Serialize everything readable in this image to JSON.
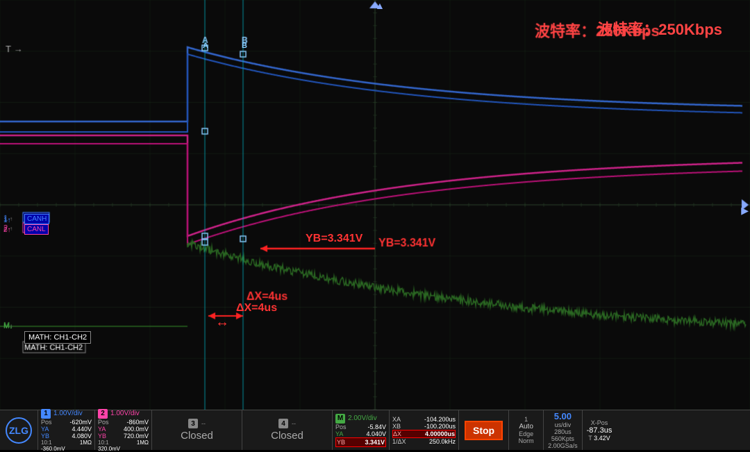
{
  "screen": {
    "baud_rate_label": "波特率：250Kbps",
    "canh": "CANH",
    "canl": "CANL",
    "math_label": "MATH: CH1-CH2",
    "cursor_a": "A",
    "cursor_b": "B",
    "annotation_yb": "YB=3.341V",
    "annotation_dx": "ΔX=4us",
    "ch1_indicator": "1↑",
    "ch2_indicator": "2↑",
    "math_indicator": "M↓"
  },
  "status_bar": {
    "ch1": {
      "number": "1",
      "div": "1.00V/div",
      "pos_label": "Pos",
      "pos_val": "-620mV",
      "ya_label": "YA",
      "ya_val": "4.440V",
      "yb_label": "YB",
      "yb_val": "4.080V",
      "ratio": "10:1",
      "unit": "1MΩ",
      "extra": "-360.0mV"
    },
    "ch2": {
      "number": "2",
      "div": "1.00V/div",
      "pos_label": "Pos",
      "pos_val": "-860mV",
      "ya_label": "YA",
      "ya_val": "400.0mV",
      "yb_label": "YB",
      "yb_val": "720.0mV",
      "ratio": "10:1",
      "unit": "1MΩ",
      "extra": "320.0mV"
    },
    "ch3": {
      "number": "3",
      "div": "--",
      "closed": "Closed"
    },
    "ch4": {
      "number": "4",
      "div": "--",
      "closed": "Closed"
    },
    "math": {
      "label": "MATH",
      "div": "2.00V/div",
      "pos_label": "Pos",
      "pos_val": "-5.84V",
      "ya_label": "YA",
      "ya_val": "4.040V",
      "yb_label": "YB",
      "yb_val": "3.341V"
    },
    "measurements": {
      "xa_label": "XA",
      "xa_val": "-104.200us",
      "xb_label": "XB",
      "xb_val": "-100.200us",
      "ax_label": "ΔX",
      "ax_val": "4.00000us",
      "inv_dx_label": "1/ΔX",
      "inv_dx_val": "250.0kHz"
    },
    "stop_label": "Stop",
    "trigger": {
      "mode_label": "Auto",
      "edge_label": "Edge",
      "norm_label": "Norm"
    },
    "timebase": {
      "val": "5.00",
      "unit": "us/div",
      "pts": "280us",
      "sa": "560Kpts",
      "srate": "2.00GSa/s"
    },
    "xpos": {
      "label": "X-Pos",
      "val": "-87.3us",
      "t_label": "T",
      "t_val": "3.42V"
    }
  }
}
